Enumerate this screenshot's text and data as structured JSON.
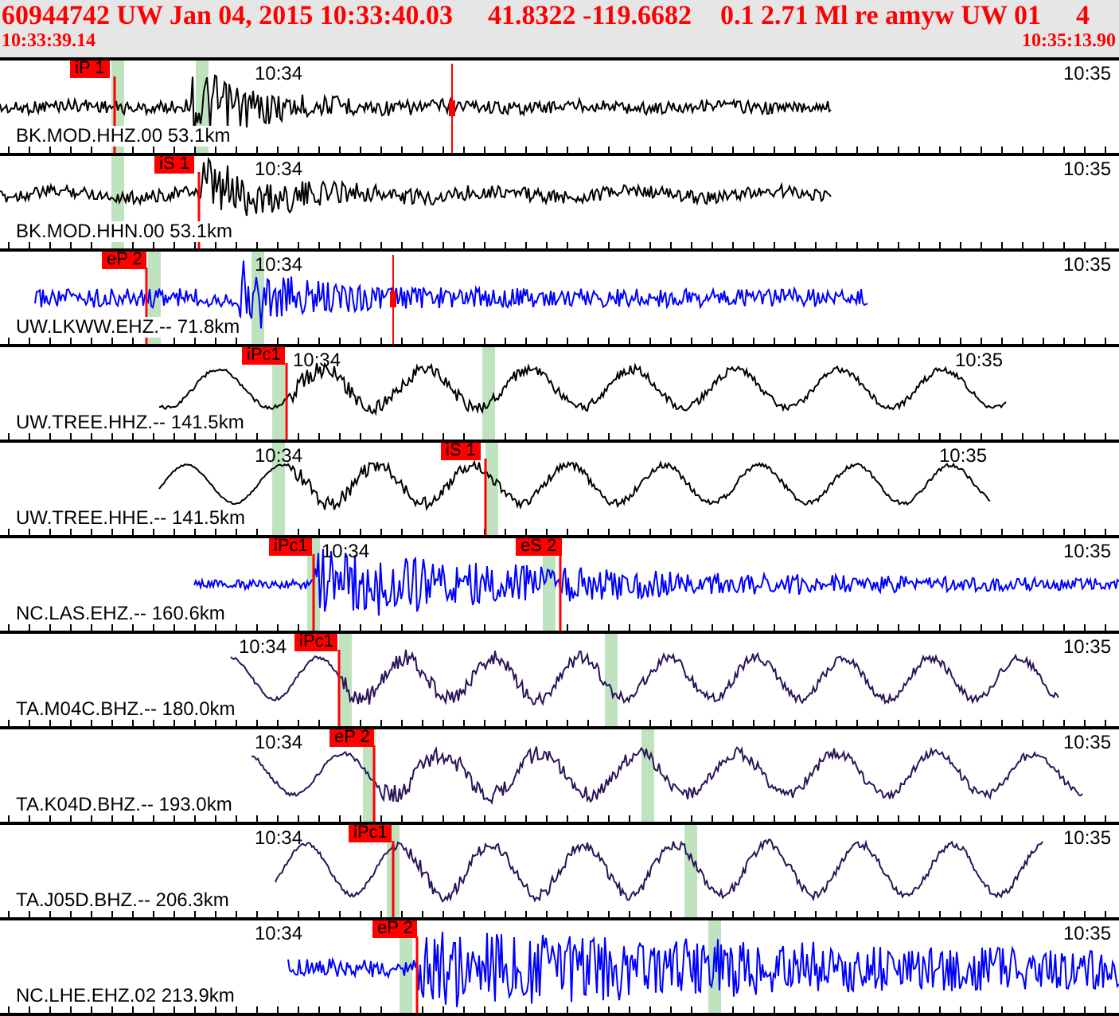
{
  "header": {
    "event": "60944742 UW Jan 04, 2015 10:33:40.03",
    "location": "41.8322 -119.6682",
    "magnitude": "0.1 2.71 Ml re amyw UW 01",
    "count": "4",
    "start_time": "10:33:39.14",
    "end_time": "10:35:13.90"
  },
  "traces": [
    {
      "label": "BK.MOD.HHZ.00 53.1km",
      "color": "#000000",
      "time_start": "10:34",
      "time_end": "10:35",
      "picks": [
        {
          "label": "iP 1"
        }
      ]
    },
    {
      "label": "BK.MOD.HHN.00 53.1km",
      "color": "#000000",
      "time_start": "10:34",
      "time_end": "10:35",
      "picks": [
        {
          "label": "iS 1"
        }
      ]
    },
    {
      "label": "UW.LKWW.EHZ.-- 71.8km",
      "color": "#0000ff",
      "time_start": "10:34",
      "time_end": "10:35",
      "picks": [
        {
          "label": "eP 2"
        }
      ]
    },
    {
      "label": "UW.TREE.HHZ.-- 141.5km",
      "color": "#000000",
      "time_start": "10:34",
      "time_end": "10:35",
      "picks": [
        {
          "label": "iPc1"
        }
      ]
    },
    {
      "label": "UW.TREE.HHE.-- 141.5km",
      "color": "#000000",
      "time_start": "10:34",
      "time_end": "10:35",
      "picks": [
        {
          "label": "iS 1"
        }
      ]
    },
    {
      "label": "NC.LAS.EHZ.-- 160.6km",
      "color": "#0000ff",
      "time_start": "10:34",
      "time_end": "10:35",
      "picks": [
        {
          "label": "iPc1"
        },
        {
          "label": "eS 2"
        }
      ]
    },
    {
      "label": "TA.M04C.BHZ.-- 180.0km",
      "color": "#2a1458",
      "time_start": "10:34",
      "time_end": "10:35",
      "picks": [
        {
          "label": "iPc1"
        }
      ]
    },
    {
      "label": "TA.K04D.BHZ.-- 193.0km",
      "color": "#2a1458",
      "time_start": "10:34",
      "time_end": "10:35",
      "picks": [
        {
          "label": "eP 2"
        }
      ]
    },
    {
      "label": "TA.J05D.BHZ.-- 206.3km",
      "color": "#2a1458",
      "time_start": "10:34",
      "time_end": "10:35",
      "picks": [
        {
          "label": "iPc1"
        }
      ]
    },
    {
      "label": "NC.LHE.EHZ.02 213.9km",
      "color": "#0000ff",
      "time_start": "10:34",
      "time_end": "10:35",
      "picks": [
        {
          "label": "eP 2"
        }
      ]
    }
  ]
}
